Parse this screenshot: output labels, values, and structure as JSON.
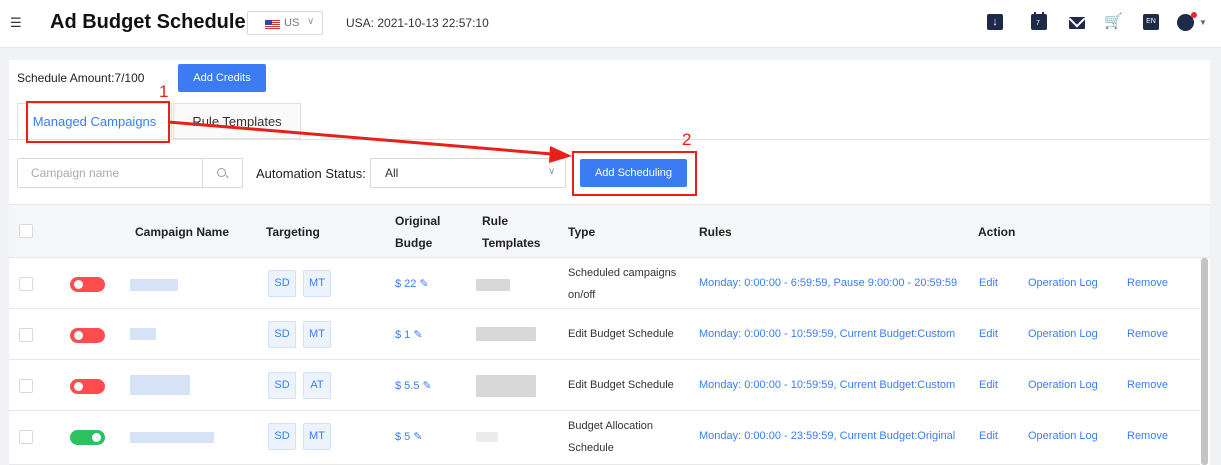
{
  "header": {
    "title": "Ad Budget Schedule",
    "country": "US",
    "datetime": "USA: 2021-10-13 22:57:10",
    "icons": [
      "menu-fold-icon",
      "download-icon",
      "calendar-icon",
      "mail-icon",
      "cart-icon",
      "language-icon",
      "user-avatar-icon"
    ],
    "calendar_day": "7",
    "language": "EN"
  },
  "toolbar": {
    "schedule_amount": "Schedule Amount:7/100",
    "add_credits": "Add Credits"
  },
  "tabs": [
    {
      "label": "Managed Campaigns",
      "active": true
    },
    {
      "label": "Rule Templates",
      "active": false
    }
  ],
  "filters": {
    "campaign_placeholder": "Campaign name",
    "automation_label": "Automation Status:",
    "automation_value": "All",
    "add_scheduling": "Add Scheduling"
  },
  "annotations": {
    "box1": "1",
    "box2": "2",
    "color": "#e8201a"
  },
  "table": {
    "headers": {
      "campaign_name": "Campaign Name",
      "targeting": "Targeting",
      "original_budget_1": "Original",
      "original_budget_2": "Budge",
      "rule_templates_1": "Rule",
      "rule_templates_2": "Templates",
      "type": "Type",
      "rules": "Rules",
      "action": "Action"
    },
    "rows": [
      {
        "status": "off",
        "tags": [
          "SD",
          "MT"
        ],
        "budget": "$ 22",
        "type_1": "Scheduled campaigns",
        "type_2": "on/off",
        "rules": "Monday:  0:00:00 - 6:59:59,  Pause 9:00:00 - 20:59:59",
        "edit": "Edit",
        "log": "Operation Log",
        "remove": "Remove"
      },
      {
        "status": "off",
        "tags": [
          "SD",
          "MT"
        ],
        "budget": "$ 1",
        "type_1": "Edit Budget Schedule",
        "type_2": "",
        "rules": "Monday:  0:00:00 - 10:59:59,  Current Budget:Custom",
        "edit": "Edit",
        "log": "Operation Log",
        "remove": "Remove"
      },
      {
        "status": "off",
        "tags": [
          "SD",
          "AT"
        ],
        "budget": "$ 5.5",
        "type_1": "Edit Budget Schedule",
        "type_2": "",
        "rules": "Monday:  0:00:00 - 10:59:59,  Current Budget:Custom",
        "edit": "Edit",
        "log": "Operation Log",
        "remove": "Remove"
      },
      {
        "status": "on",
        "tags": [
          "SD",
          "MT"
        ],
        "budget": "$ 5",
        "type_1": "Budget Allocation",
        "type_2": "Schedule",
        "rules": "Monday:  0:00:00 - 23:59:59,  Current Budget:Original",
        "edit": "Edit",
        "log": "Operation Log",
        "remove": "Remove"
      }
    ]
  },
  "colors": {
    "primary": "#3b7cf5",
    "toggle_off": "#ff4d4f",
    "toggle_on": "#2bc25f"
  }
}
